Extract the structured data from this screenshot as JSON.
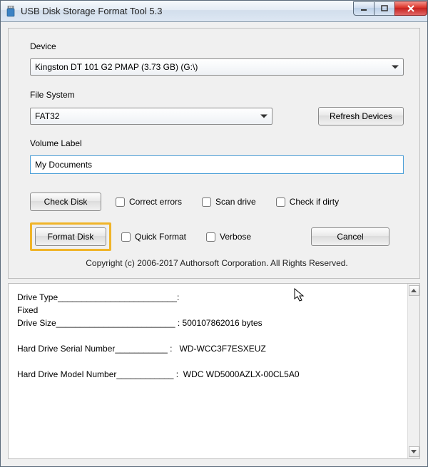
{
  "window": {
    "title": "USB Disk Storage Format Tool 5.3"
  },
  "labels": {
    "device": "Device",
    "filesystem": "File System",
    "volume_label": "Volume Label"
  },
  "device": {
    "selected": "Kingston  DT 101 G2  PMAP (3.73 GB) (G:\\)"
  },
  "filesystem": {
    "selected": "FAT32"
  },
  "buttons": {
    "refresh": "Refresh Devices",
    "check_disk": "Check Disk",
    "format_disk": "Format Disk",
    "cancel": "Cancel"
  },
  "volume_label_value": "My Documents",
  "checks": {
    "correct_errors": "Correct errors",
    "scan_drive": "Scan drive",
    "check_if_dirty": "Check if dirty",
    "quick_format": "Quick Format",
    "verbose": "Verbose"
  },
  "copyright": "Copyright (c) 2006-2017 Authorsoft Corporation. All Rights Reserved.",
  "info": {
    "line1": "Drive Type_________________________:",
    "line2": "Fixed",
    "line3": "Drive Size_________________________ : 500107862016 bytes",
    "blank1": "",
    "line4": "Hard Drive Serial Number___________ :   WD-WCC3F7ESXEUZ",
    "blank2": "",
    "line5": "Hard Drive Model Number____________ :  WDC WD5000AZLX-00CL5A0"
  }
}
